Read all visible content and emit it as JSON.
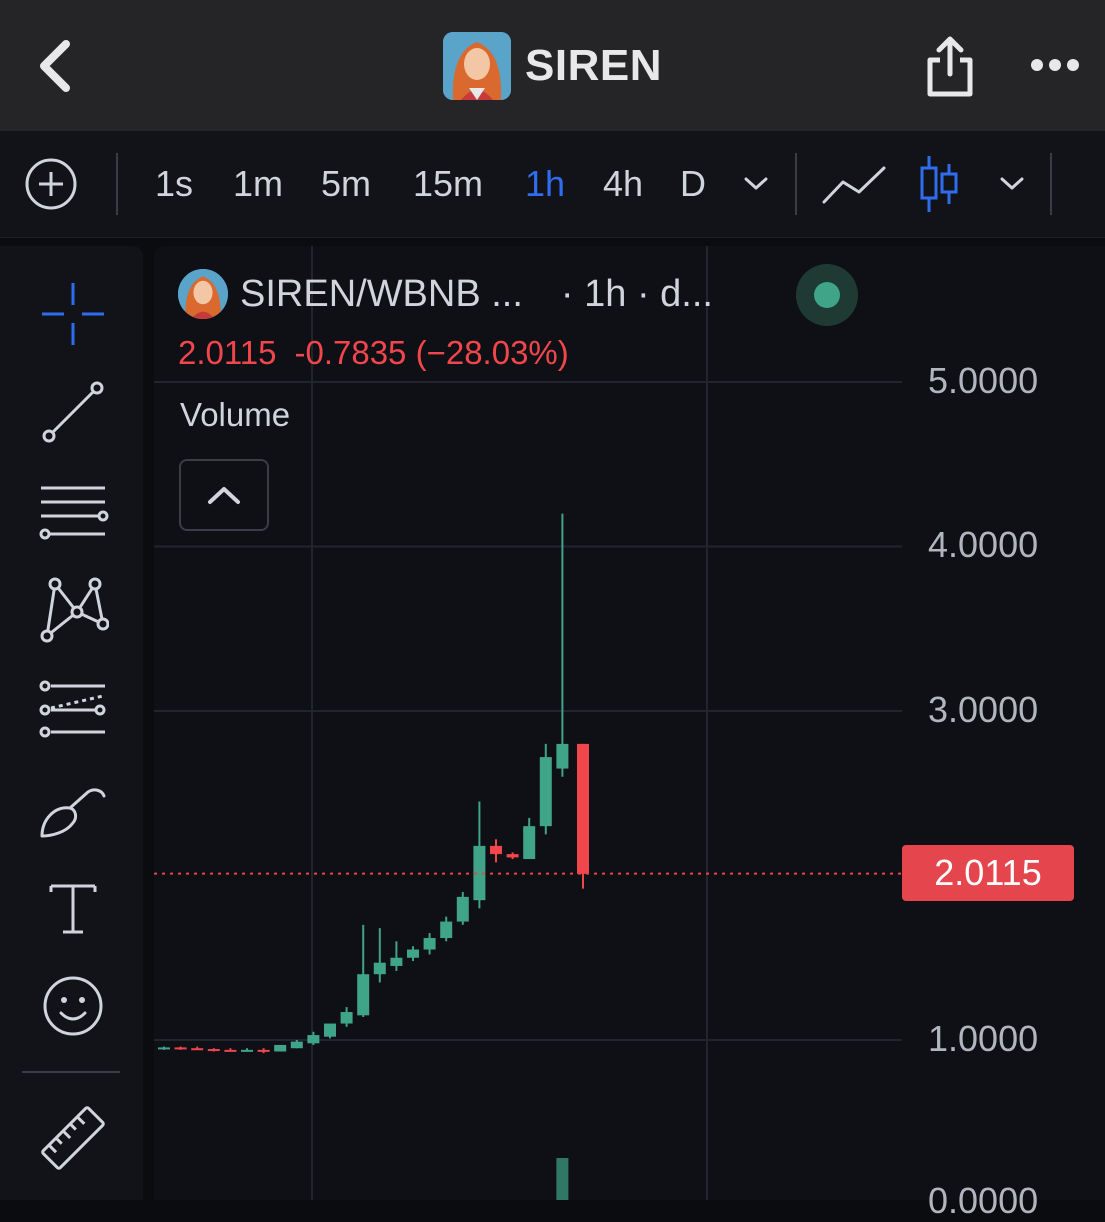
{
  "header": {
    "title": "SIREN",
    "back_icon": "chevron-left-icon",
    "share_icon": "share-icon",
    "more_icon": "more-horizontal-icon"
  },
  "toolbar": {
    "add_icon": "plus-circle-icon",
    "timeframes": [
      "1s",
      "1m",
      "5m",
      "15m",
      "1h",
      "4h",
      "D"
    ],
    "active_timeframe": "1h",
    "timeframe_dropdown_icon": "chevron-down-icon",
    "chart_type_line_icon": "line-chart-icon",
    "chart_type_candle_icon": "candlestick-icon",
    "chart_type_dropdown_icon": "chevron-down-icon",
    "accent_color": "#2f6cf0"
  },
  "tools": [
    {
      "icon": "crosshair-icon"
    },
    {
      "icon": "trend-line-icon"
    },
    {
      "icon": "horizontal-lines-icon"
    },
    {
      "icon": "pattern-icon"
    },
    {
      "icon": "fib-lines-icon"
    },
    {
      "icon": "brush-icon"
    },
    {
      "icon": "text-icon"
    },
    {
      "icon": "emoji-icon"
    },
    {
      "icon": "ruler-icon"
    }
  ],
  "legend": {
    "symbol": "SIREN/WBNB ...",
    "interval": "· 1h · d...",
    "price": "2.0115",
    "change": "-0.7835",
    "change_pct": "(−28.03%)",
    "down_color": "#f0464c",
    "up_color": "#3fa488"
  },
  "volume": {
    "label": "Volume",
    "collapse_icon": "chevron-up-icon"
  },
  "chart_data": {
    "type": "candlestick",
    "y_axis": {
      "labels": [
        "5.0000",
        "4.0000",
        "3.0000",
        "1.0000",
        "0.0000"
      ],
      "ylim": [
        0,
        5
      ]
    },
    "last_price": "2.0115",
    "candles": [
      {
        "o": 0.95,
        "h": 0.96,
        "l": 0.94,
        "c": 0.955
      },
      {
        "o": 0.955,
        "h": 0.96,
        "l": 0.94,
        "c": 0.95
      },
      {
        "o": 0.95,
        "h": 0.96,
        "l": 0.94,
        "c": 0.945
      },
      {
        "o": 0.945,
        "h": 0.95,
        "l": 0.93,
        "c": 0.94
      },
      {
        "o": 0.94,
        "h": 0.95,
        "l": 0.93,
        "c": 0.935
      },
      {
        "o": 0.935,
        "h": 0.95,
        "l": 0.93,
        "c": 0.94
      },
      {
        "o": 0.94,
        "h": 0.95,
        "l": 0.92,
        "c": 0.93
      },
      {
        "o": 0.93,
        "h": 0.96,
        "l": 0.93,
        "c": 0.97
      },
      {
        "o": 0.95,
        "h": 1.0,
        "l": 0.95,
        "c": 0.99
      },
      {
        "o": 0.98,
        "h": 1.05,
        "l": 0.97,
        "c": 1.03
      },
      {
        "o": 1.02,
        "h": 1.1,
        "l": 1.01,
        "c": 1.1
      },
      {
        "o": 1.1,
        "h": 1.2,
        "l": 1.08,
        "c": 1.17
      },
      {
        "o": 1.15,
        "h": 1.7,
        "l": 1.14,
        "c": 1.4
      },
      {
        "o": 1.4,
        "h": 1.68,
        "l": 1.35,
        "c": 1.47
      },
      {
        "o": 1.45,
        "h": 1.6,
        "l": 1.42,
        "c": 1.5
      },
      {
        "o": 1.5,
        "h": 1.57,
        "l": 1.48,
        "c": 1.55
      },
      {
        "o": 1.55,
        "h": 1.65,
        "l": 1.52,
        "c": 1.62
      },
      {
        "o": 1.62,
        "h": 1.75,
        "l": 1.6,
        "c": 1.72
      },
      {
        "o": 1.72,
        "h": 1.9,
        "l": 1.7,
        "c": 1.87
      },
      {
        "o": 1.85,
        "h": 2.45,
        "l": 1.8,
        "c": 2.18
      },
      {
        "o": 2.18,
        "h": 2.22,
        "l": 2.08,
        "c": 2.13
      },
      {
        "o": 2.13,
        "h": 2.14,
        "l": 2.1,
        "c": 2.11
      },
      {
        "o": 2.1,
        "h": 2.35,
        "l": 2.1,
        "c": 2.3
      },
      {
        "o": 2.3,
        "h": 2.8,
        "l": 2.25,
        "c": 2.72
      },
      {
        "o": 2.65,
        "h": 4.2,
        "l": 2.6,
        "c": 2.8
      },
      {
        "o": 2.8,
        "h": 2.8,
        "l": 1.92,
        "c": 2.01
      }
    ]
  }
}
